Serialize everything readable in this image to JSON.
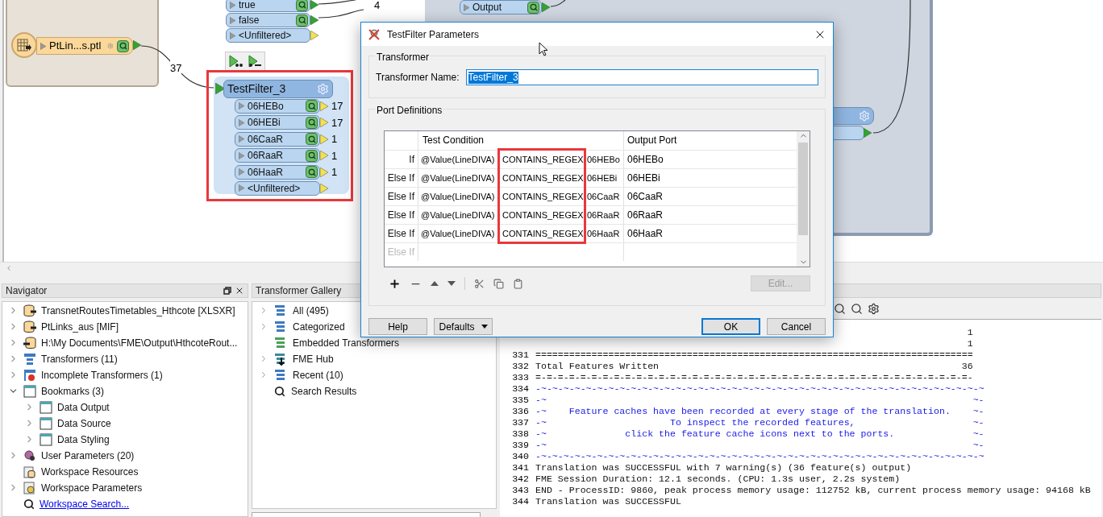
{
  "canvas": {
    "reader": {
      "label": "PtLin...s.ptl",
      "feature_count": "37"
    },
    "upper_node": {
      "count": "4",
      "ports": [
        {
          "label": "true",
          "cached": true,
          "connected": true
        },
        {
          "label": "false",
          "cached": true,
          "connected": true
        },
        {
          "label": "<Unfiltered>",
          "cached": false,
          "connected": false
        }
      ]
    },
    "output_port": {
      "label": "Output",
      "cached": true,
      "connected": true
    },
    "test_filter": {
      "title": "TestFilter_3",
      "ports": [
        {
          "label": "06HEBo",
          "count": "17",
          "cached": true,
          "connected": false
        },
        {
          "label": "06HEBi",
          "count": "17",
          "cached": true,
          "connected": false
        },
        {
          "label": "06CaaR",
          "count": "1",
          "cached": true,
          "connected": false
        },
        {
          "label": "06RaaR",
          "count": "1",
          "cached": true,
          "connected": false
        },
        {
          "label": "06HaaR",
          "count": "1",
          "cached": true,
          "connected": false
        },
        {
          "label": "<Unfiltered>",
          "cached": false,
          "connected": false
        }
      ]
    }
  },
  "dialog": {
    "title": "TestFilter Parameters",
    "transformer_group": {
      "title": "Transformer",
      "name_label": "Transformer Name:",
      "name_value": "TestFilter_3"
    },
    "ports_group": {
      "title": "Port Definitions",
      "columns": [
        "Test Condition",
        "Output Port"
      ],
      "rows": [
        {
          "prefix": "If",
          "operand": "@Value(LineDIVA)",
          "operator": "CONTAINS_REGEX",
          "value": "06HEBo",
          "output": "06HEBo",
          "disabled": false
        },
        {
          "prefix": "Else If",
          "operand": "@Value(LineDIVA)",
          "operator": "CONTAINS_REGEX",
          "value": "06HEBi",
          "output": "06HEBi",
          "disabled": false
        },
        {
          "prefix": "Else If",
          "operand": "@Value(LineDIVA)",
          "operator": "CONTAINS_REGEX",
          "value": "06CaaR",
          "output": "06CaaR",
          "disabled": false
        },
        {
          "prefix": "Else If",
          "operand": "@Value(LineDIVA)",
          "operator": "CONTAINS_REGEX",
          "value": "06RaaR",
          "output": "06RaaR",
          "disabled": false
        },
        {
          "prefix": "Else If",
          "operand": "@Value(LineDIVA)",
          "operator": "CONTAINS_REGEX",
          "value": "06HaaR",
          "output": "06HaaR",
          "disabled": false
        },
        {
          "prefix": "Else If",
          "disabled": true
        }
      ],
      "edit_button": {
        "label": "Edit...",
        "disabled": true
      }
    },
    "buttons": [
      {
        "label": "Help",
        "kind": "plain"
      },
      {
        "label": "Defaults",
        "kind": "menu"
      },
      {
        "label": "OK",
        "kind": "default"
      },
      {
        "label": "Cancel",
        "kind": "plain"
      }
    ]
  },
  "navigator": {
    "title": "Navigator",
    "items": [
      {
        "label": "TransnetRoutesTimetables_Hthcote [XLSXR]",
        "kind": "reader",
        "expandable": true,
        "expanded": false
      },
      {
        "label": "PtLinks_aus [MIF]",
        "kind": "reader",
        "expandable": true,
        "expanded": false
      },
      {
        "label": "H:\\My Documents\\FME\\Output\\HthcoteRout...",
        "kind": "writer",
        "expandable": true,
        "expanded": false
      },
      {
        "label": "Transformers (11)",
        "kind": "transformers",
        "expandable": true,
        "expanded": false
      },
      {
        "label": "Incomplete Transformers (1)",
        "kind": "incomplete",
        "expandable": true,
        "expanded": false
      },
      {
        "label": "Bookmarks (3)",
        "kind": "bookmark",
        "expandable": true,
        "expanded": true,
        "children": [
          {
            "label": "Data Output",
            "kind": "bookmark",
            "expandable": true,
            "expanded": false
          },
          {
            "label": "Data Source",
            "kind": "bookmark",
            "expandable": true,
            "expanded": false
          },
          {
            "label": "Data Styling",
            "kind": "bookmark",
            "expandable": true,
            "expanded": false
          }
        ]
      },
      {
        "label": "User Parameters (20)",
        "kind": "user_params",
        "expandable": true,
        "expanded": false
      },
      {
        "label": "Workspace Resources",
        "kind": "resources",
        "expandable": false
      },
      {
        "label": "Workspace Parameters",
        "kind": "workspace_params",
        "expandable": true,
        "expanded": false
      },
      {
        "label": "Workspace Search...",
        "kind": "search",
        "expandable": false
      }
    ]
  },
  "transformer_gallery": {
    "title": "Transformer Gallery",
    "items": [
      {
        "label": "All (495)",
        "kind": "list",
        "expandable": true
      },
      {
        "label": "Categorized",
        "kind": "list",
        "expandable": true
      },
      {
        "label": "Embedded Transformers",
        "kind": "embedded",
        "expandable": false
      },
      {
        "label": "FME Hub",
        "kind": "hub",
        "expandable": true
      },
      {
        "label": "Recent (10)",
        "kind": "list",
        "expandable": true
      },
      {
        "label": "Search Results",
        "kind": "search",
        "expandable": false
      }
    ]
  },
  "log": {
    "lines": [
      {
        "value": "1",
        "kind": "plain"
      },
      {
        "value": "1",
        "kind": "plain"
      },
      {
        "number": "331",
        "text": "==============================================================================",
        "kind": "plain"
      },
      {
        "number": "332",
        "text": "Total Features Written",
        "value": "36",
        "kind": "plain"
      },
      {
        "number": "333",
        "text": "=-=-=-=-=-=-=-=-=-=-=-=-=-=-=-=-=-=-=-=-=-=-=-=-=-=-=-=-=-=-=-=-=-=-=-=-=-=-=-",
        "kind": "plain"
      },
      {
        "number": "334",
        "text": "-~-~-~-~-~-~-~-~-~-~-~-~-~-~-~-~-~-~-~-~-~-~-~-~-~-~-~-~-~-~-~-~-~-~-~-~-~-~-~-~",
        "kind": "note"
      },
      {
        "number": "335",
        "text": "-~",
        "value": "~-",
        "kind": "note"
      },
      {
        "number": "336",
        "text": "-~    Feature caches have been recorded at every stage of the translation.",
        "value": "~-",
        "kind": "note"
      },
      {
        "number": "337",
        "text": "-~                      To inspect the recorded features,",
        "value": "~-",
        "kind": "note"
      },
      {
        "number": "338",
        "text": "-~              click the feature cache icons next to the ports.",
        "value": "~-",
        "kind": "note"
      },
      {
        "number": "339",
        "text": "-~",
        "value": "~-",
        "kind": "note"
      },
      {
        "number": "340",
        "text": "-~-~-~-~-~-~-~-~-~-~-~-~-~-~-~-~-~-~-~-~-~-~-~-~-~-~-~-~-~-~-~-~-~-~-~-~-~-~-~-~",
        "kind": "note"
      },
      {
        "number": "341",
        "text": "Translation was SUCCESSFUL with 7 warning(s) (36 feature(s) output)",
        "kind": "plain"
      },
      {
        "number": "342",
        "text": "FME Session Duration: 12.1 seconds. (CPU: 1.3s user, 2.2s system)",
        "kind": "plain"
      },
      {
        "number": "343",
        "text": "END - ProcessID: 9860, peak process memory usage: 112752 kB, current process memory usage: 94168 kB",
        "kind": "plain"
      },
      {
        "number": "344",
        "text": "Translation was SUCCESSFUL",
        "kind": "plain"
      }
    ]
  }
}
